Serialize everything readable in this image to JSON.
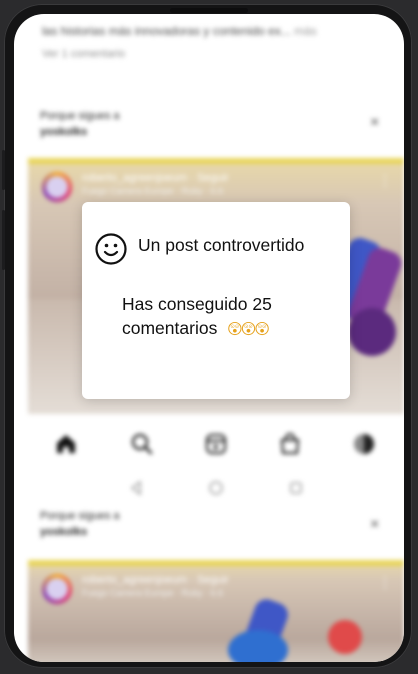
{
  "feed": {
    "caption": "las historias más innovadoras y contenido ex...",
    "caption_more": "más",
    "view_comments": "Ver 1 comentario",
    "suggestions": [
      {
        "reason_line1": "Porque sigues a",
        "reason_line2": "yoskolks",
        "close": "×"
      },
      {
        "reason_line1": "Porque sigues a",
        "reason_line2": "yoskolks",
        "close": "×"
      }
    ],
    "posts": [
      {
        "user": "roberto_agreenjoeum · Seguir",
        "sub": "Fuego Camera Europe · Ruby · 6.6",
        "more": "⋮"
      },
      {
        "user": "roberto_agreenjoeum · Seguir",
        "sub": "Fuego Camera Europe · Ruby · 6.6",
        "more": "⋮"
      }
    ]
  },
  "bottom_nav": {
    "icons": [
      "home-icon",
      "search-icon",
      "reels-icon",
      "shop-icon",
      "profile-avatar"
    ]
  },
  "system_nav": {
    "icons": [
      "back-icon",
      "home-circle-icon",
      "recents-icon"
    ]
  },
  "dialog": {
    "icon": "smiley-face-icon",
    "title": "Un post controvertido",
    "body_line1": "Has conseguido 25",
    "body_line2": "comentarios",
    "emojis": "😲😲😲"
  },
  "colors": {
    "accent_yellow": "#e8d55a",
    "dialog_bg": "#ffffff",
    "text": "#111111"
  }
}
